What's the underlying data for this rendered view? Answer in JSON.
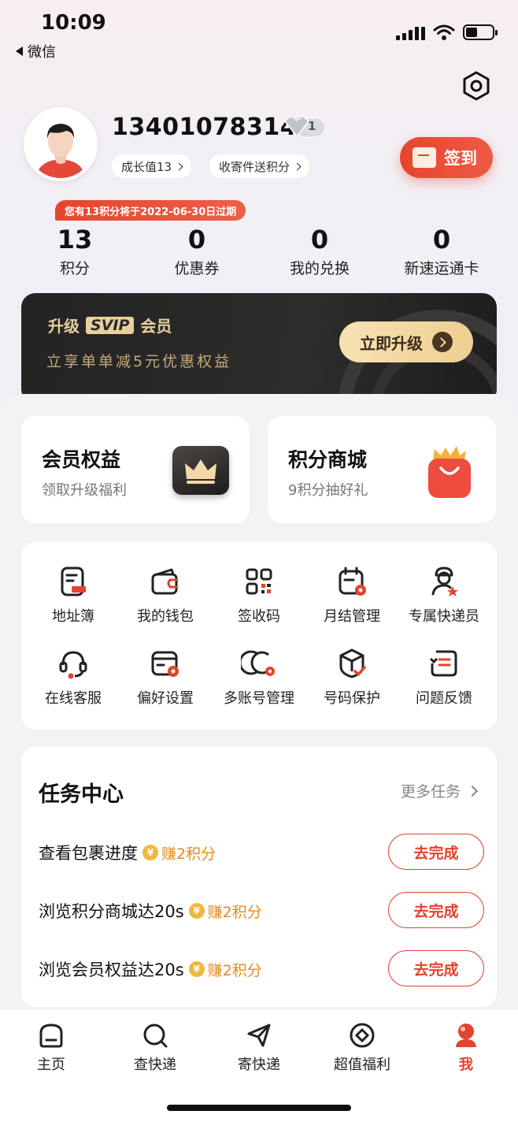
{
  "status_bar": {
    "time": "10:09",
    "back_label": "微信"
  },
  "profile": {
    "phone": "13401078314",
    "level": "1",
    "growth_chip": "成长值13",
    "points_chip": "收寄件送积分",
    "signin_label": "签到"
  },
  "expire_tip": "您有13积分将于2022-06-30日过期",
  "stats": [
    {
      "value": "13",
      "label": "积分"
    },
    {
      "value": "0",
      "label": "优惠券"
    },
    {
      "value": "0",
      "label": "我的兑换"
    },
    {
      "value": "0",
      "label": "新速运通卡"
    }
  ],
  "vip": {
    "prefix": "升级",
    "svip": "SVIP",
    "suffix": "会员",
    "subtitle": "立享单单减5元优惠权益",
    "button": "立即升级"
  },
  "promos": [
    {
      "title": "会员权益",
      "subtitle": "领取升级福利"
    },
    {
      "title": "积分商城",
      "subtitle": "9积分抽好礼"
    }
  ],
  "tools": [
    {
      "label": "地址簿",
      "icon": "address-book-icon"
    },
    {
      "label": "我的钱包",
      "icon": "wallet-icon"
    },
    {
      "label": "签收码",
      "icon": "qr-code-icon"
    },
    {
      "label": "月结管理",
      "icon": "calendar-settings-icon"
    },
    {
      "label": "专属快递员",
      "icon": "courier-icon"
    },
    {
      "label": "在线客服",
      "icon": "headset-icon"
    },
    {
      "label": "偏好设置",
      "icon": "preference-icon"
    },
    {
      "label": "多账号管理",
      "icon": "multi-account-icon"
    },
    {
      "label": "号码保护",
      "icon": "shield-box-icon"
    },
    {
      "label": "问题反馈",
      "icon": "feedback-icon"
    }
  ],
  "tasks": {
    "title": "任务中心",
    "more": "更多任务",
    "items": [
      {
        "name": "查看包裹进度",
        "coin": "¥",
        "reward": "赚2积分",
        "button": "去完成"
      },
      {
        "name": "浏览积分商城达20s",
        "coin": "¥",
        "reward": "赚2积分",
        "button": "去完成"
      },
      {
        "name": "浏览会员权益达20s",
        "coin": "¥",
        "reward": "赚2积分",
        "button": "去完成"
      }
    ]
  },
  "tabbar": [
    {
      "label": "主页",
      "icon": "home-icon"
    },
    {
      "label": "查快递",
      "icon": "search-icon"
    },
    {
      "label": "寄快递",
      "icon": "send-icon"
    },
    {
      "label": "超值福利",
      "icon": "coupon-icon"
    },
    {
      "label": "我",
      "icon": "profile-icon",
      "active": true
    }
  ],
  "colors": {
    "accent": "#e2432e",
    "gold": "#e9cf9d",
    "coin": "#f3b740"
  }
}
